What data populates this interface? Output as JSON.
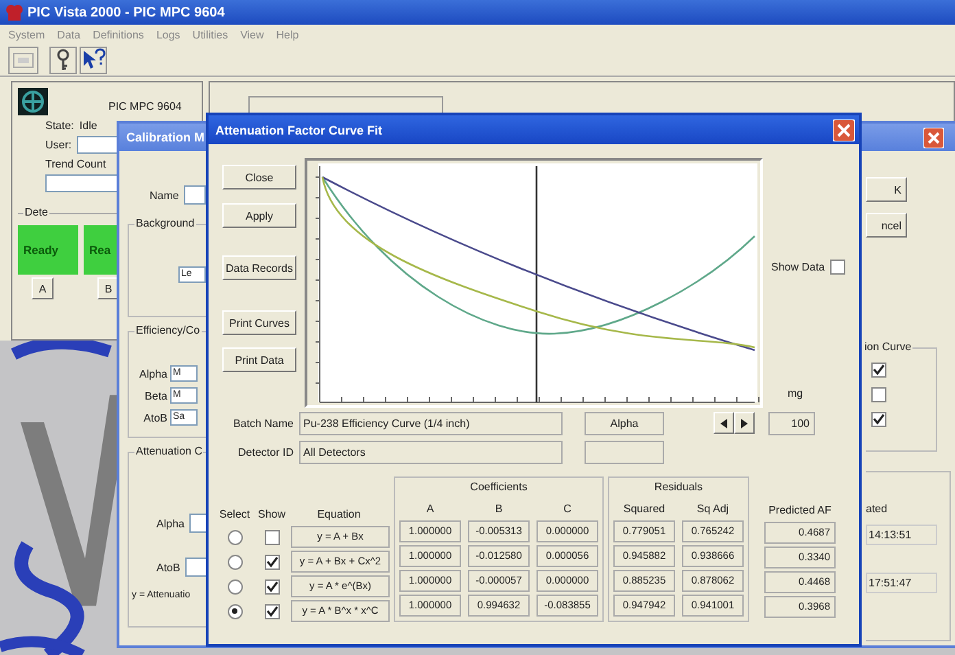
{
  "app": {
    "title": "PIC Vista 2000 - PIC MPC 9604",
    "menu": [
      "System",
      "Data",
      "Definitions",
      "Logs",
      "Utilities",
      "View",
      "Help"
    ]
  },
  "instrument": {
    "name": "PIC MPC 9604",
    "state_label": "State:",
    "state": "Idle",
    "user_label": "User:",
    "trend_label": "Trend Count",
    "detector_group": "Dete",
    "detectors": [
      {
        "status": "Ready",
        "button": "A"
      },
      {
        "status": "Rea",
        "button": "B"
      }
    ]
  },
  "calibration_dialog": {
    "title": "Calibration M",
    "name_label": "Name",
    "background_group": "Background",
    "background_field": "Le",
    "efficiency_group": "Efficiency/Co",
    "efficiency_rows": [
      {
        "label": "Alpha",
        "value": "M"
      },
      {
        "label": "Beta",
        "value": "M"
      },
      {
        "label": "AtoB",
        "value": "Sa"
      }
    ],
    "attenuation_group": "Attenuation C",
    "attenuation_rows": [
      {
        "label": "Alpha"
      },
      {
        "label": "AtoB"
      }
    ],
    "formula_note": "y = Attenuatio",
    "buttons": [
      "K",
      "ncel"
    ],
    "curve_group": "ion Curve",
    "curve_checks": [
      {
        "checked": true
      },
      {
        "checked": false
      },
      {
        "checked": true
      }
    ],
    "dates_group": "ated",
    "times": [
      "14:13:51",
      "17:51:47"
    ]
  },
  "fit_dialog": {
    "title": "Attenuation Factor Curve Fit",
    "buttons": [
      "Close",
      "Apply",
      "Data Records",
      "Print Curves",
      "Print Data"
    ],
    "show_data": {
      "label": "Show Data",
      "checked": false
    },
    "batch_label": "Batch Name",
    "batch_name": "Pu-238 Efficiency Curve (1/4 inch)",
    "detector_label": "Detector ID",
    "detector_id": "All Detectors",
    "particle": "Alpha",
    "unit": "mg",
    "mass": "100",
    "columns": {
      "select": "Select",
      "show": "Show",
      "equation": "Equation",
      "coefficients": "Coefficients",
      "a": "A",
      "b": "B",
      "c": "C",
      "residuals": "Residuals",
      "squared": "Squared",
      "sq_adj": "Sq Adj",
      "predicted": "Predicted AF"
    },
    "rows": [
      {
        "selected": false,
        "show": false,
        "equation": "y = A + Bx",
        "a": "1.000000",
        "b": "-0.005313",
        "c": "0.000000",
        "squared": "0.779051",
        "sq_adj": "0.765242",
        "predicted": "0.4687"
      },
      {
        "selected": false,
        "show": true,
        "equation": "y = A + Bx + Cx^2",
        "a": "1.000000",
        "b": "-0.012580",
        "c": "0.000056",
        "squared": "0.945882",
        "sq_adj": "0.938666",
        "predicted": "0.3340"
      },
      {
        "selected": false,
        "show": true,
        "equation": "y = A * e^(Bx)",
        "a": "1.000000",
        "b": "-0.000057",
        "c": "0.000000",
        "squared": "0.885235",
        "sq_adj": "0.878062",
        "predicted": "0.4468"
      },
      {
        "selected": true,
        "show": true,
        "equation": "y = A * B^x * x^C",
        "a": "1.000000",
        "b": "0.994632",
        "c": "-0.083855",
        "squared": "0.947942",
        "sq_adj": "0.941001",
        "predicted": "0.3968"
      }
    ]
  }
}
